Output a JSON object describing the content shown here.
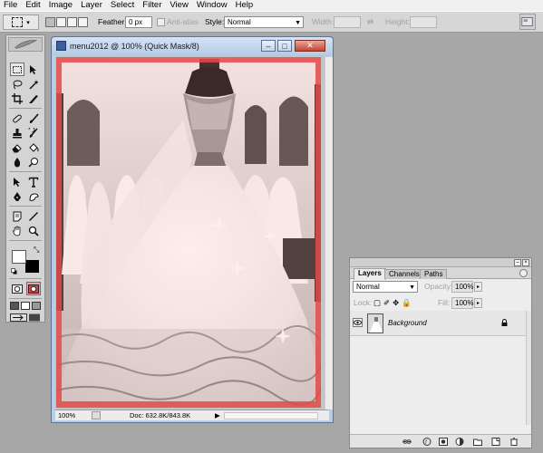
{
  "menu": [
    "File",
    "Edit",
    "Image",
    "Layer",
    "Select",
    "Filter",
    "View",
    "Window",
    "Help"
  ],
  "options": {
    "feather_label": "Feather:",
    "feather_value": "0 px",
    "antialias_label": "Anti-alias",
    "style_label": "Style:",
    "style_value": "Normal",
    "width_label": "Width:",
    "height_label": "Height:"
  },
  "document": {
    "title": "menu2012 @ 100% (Quick Mask/8)",
    "zoom": "100%",
    "doc_size": "Doc: 632.8K/843.8K"
  },
  "layers_panel": {
    "tabs": [
      "Layers",
      "Channels",
      "Paths"
    ],
    "blend_mode": "Normal",
    "opacity_label": "Opacity:",
    "opacity_value": "100%",
    "lock_label": "Lock:",
    "fill_label": "Fill:",
    "fill_value": "100%",
    "layers": [
      {
        "name": "Background",
        "visible": true,
        "locked": true
      }
    ]
  },
  "colors": {
    "quick_mask_red": "#e04545",
    "workspace_gray": "#a7a7a7",
    "panel_gray": "#d4d4d4"
  }
}
